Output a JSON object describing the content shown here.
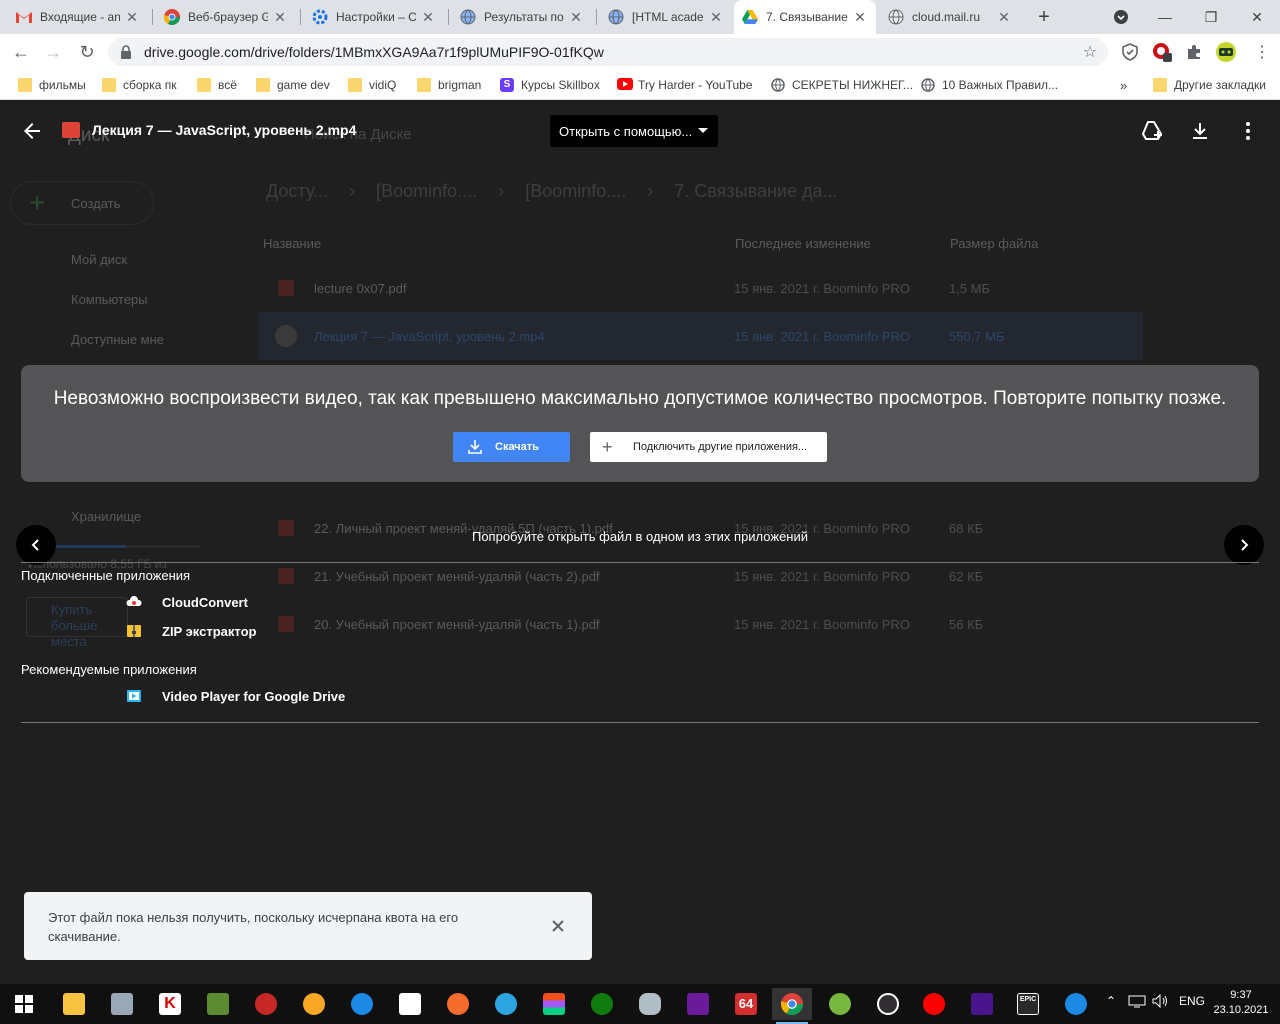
{
  "browser": {
    "tabs": [
      {
        "title": "Входящие - an",
        "icon": "gmail-icon"
      },
      {
        "title": "Веб-браузер G",
        "icon": "chrome-icon"
      },
      {
        "title": "Настройки – С",
        "icon": "settings-gear-icon"
      },
      {
        "title": "Результаты по",
        "icon": "globe-icon"
      },
      {
        "title": "[HTML academ",
        "icon": "globe-icon"
      },
      {
        "title": "7. Связывание",
        "icon": "google-drive-icon",
        "active": true
      },
      {
        "title": "cloud.mail.ru",
        "icon": "globe-icon"
      }
    ],
    "url": "drive.google.com/drive/folders/1MBmxXGA9Aa7r1f9plUMuPIF9O-01fKQw"
  },
  "bookmarks": [
    {
      "label": "фильмы",
      "icon": "folder-icon"
    },
    {
      "label": "сборка пк",
      "icon": "folder-icon"
    },
    {
      "label": "всё",
      "icon": "folder-icon"
    },
    {
      "label": "game dev",
      "icon": "folder-icon"
    },
    {
      "label": "vidiQ",
      "icon": "folder-icon"
    },
    {
      "label": "brigman",
      "icon": "folder-icon"
    },
    {
      "label": "Курсы Skillbox",
      "icon": "skillbox-icon"
    },
    {
      "label": "Try Harder - YouTube",
      "icon": "youtube-icon"
    },
    {
      "label": "СЕКРЕТЫ НИЖНЕГ...",
      "icon": "globe-icon"
    },
    {
      "label": "10 Важных Правил...",
      "icon": "globe-icon"
    },
    {
      "label": "Другие закладки",
      "icon": "folder-icon"
    }
  ],
  "drive": {
    "logo_text": "Диск",
    "search_placeholder": "Поиск на Диске",
    "create_label": "Создать",
    "sidebar": [
      "Мой диск",
      "Компьютеры",
      "Доступные мне"
    ],
    "storage_label": "Хранилище",
    "storage_used": "Использовано 8,55 ГБ из",
    "buy_more": "Купить больше места",
    "breadcrumb": [
      "Досту...",
      "[Boominfo....",
      "[Boominfo....",
      "7. Связывание да..."
    ],
    "columns": {
      "name": "Название",
      "modified": "Последнее изменение",
      "size": "Размер файла"
    },
    "files": [
      {
        "name": "lecture 0x07.pdf",
        "date": "15 янв. 2021 г. Boominfo PRO",
        "size": "1,5 МБ",
        "type": "pdf"
      },
      {
        "name": "Лекция 7 — JavaScript, уровень 2.mp4",
        "date": "15 янв. 2021 г. Boominfo PRO",
        "size": "550,7 МБ",
        "type": "video"
      },
      {
        "name": "22. Личный проект меняй-удаляй 5П (часть 1).pdf",
        "date": "15 янв. 2021 г. Boominfo PRO",
        "size": "68 КБ",
        "type": "pdf"
      },
      {
        "name": "21. Учебный проект меняй-удаляй (часть 2).pdf",
        "date": "15 янв. 2021 г. Boominfo PRO",
        "size": "62 КБ",
        "type": "pdf"
      },
      {
        "name": "20. Учебный проект меняй-удаляй (часть 1).pdf",
        "date": "15 янв. 2021 г. Boominfo PRO",
        "size": "56 КБ",
        "type": "pdf"
      }
    ]
  },
  "preview": {
    "file_title": "Лекция 7 — JavaScript, уровень 2.mp4",
    "open_with": "Открыть с помощью...",
    "error_message": "Невозможно воспроизвести видео, так как превышено максимально допустимое количество просмотров. Повторите попытку позже.",
    "download_label": "Скачать",
    "connect_label": "Подключить другие приложения...",
    "try_apps": "Попробуйте открыть файл в одном из этих приложений",
    "connected_label": "Подключенные приложения",
    "connected_apps": [
      {
        "name": "CloudConvert",
        "icon": "cloudconvert-icon"
      },
      {
        "name": "ZIP экстрактор",
        "icon": "zip-extractor-icon"
      }
    ],
    "recommended_label": "Рекомендуемые приложения",
    "recommended_apps": [
      {
        "name": "Video Player for Google Drive",
        "icon": "video-player-icon"
      }
    ]
  },
  "snackbar": {
    "message": "Этот файл пока нельзя получить, поскольку исчерпана квота на его скачивание."
  },
  "taskbar": {
    "language": "ENG",
    "time": "9:37",
    "date": "23.10.2021"
  },
  "colors": {
    "accent_blue": "#4285f4",
    "error_card": "#545456",
    "overlay_bg": "#1f1f1f"
  }
}
